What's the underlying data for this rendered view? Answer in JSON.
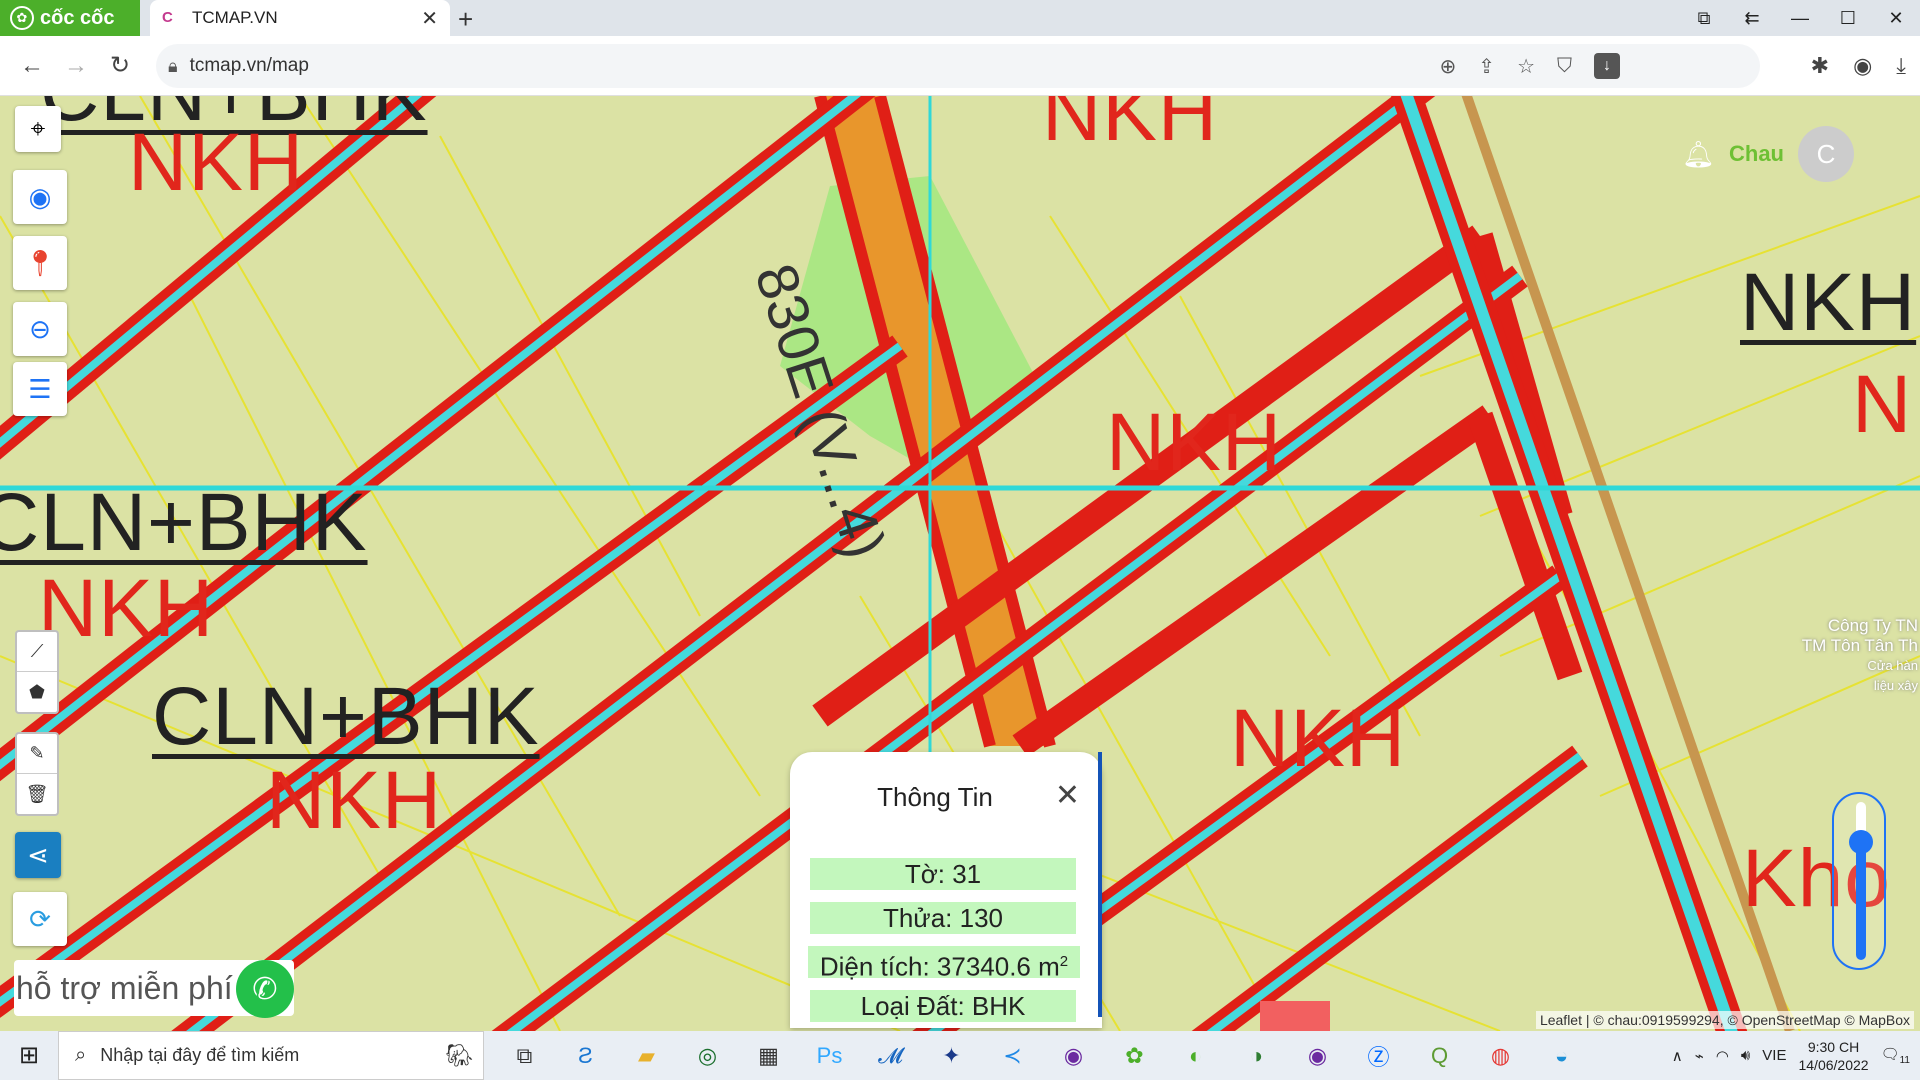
{
  "browser": {
    "brand": "cốc cốc",
    "tab_title": "TCMAP.VN",
    "url": "tcmap.vn/map"
  },
  "map": {
    "labels": [
      {
        "text": "CLN+BHK",
        "kind": "black"
      },
      {
        "text": "NKH",
        "kind": "red"
      },
      {
        "text": "NKH",
        "kind": "red"
      },
      {
        "text": "NKH",
        "kind": "red"
      },
      {
        "text": "CLN+BHK",
        "kind": "black"
      },
      {
        "text": "NKH",
        "kind": "red"
      },
      {
        "text": "CLN+BHK",
        "kind": "black"
      },
      {
        "text": "NKH",
        "kind": "red"
      },
      {
        "text": "NKH",
        "kind": "red"
      },
      {
        "text": "NKH",
        "kind": "black"
      },
      {
        "text": "N",
        "kind": "red"
      },
      {
        "text": "Kho",
        "kind": "red"
      }
    ],
    "road_label": "830E (V...4)",
    "poi": {
      "line1": "Công Ty TN",
      "line2": "TM Tôn Tân Th",
      "line3": "Cửa hàn",
      "line4": "liệu xây"
    },
    "attribution": "Leaflet | © chau:0919599294, © OpenStreetMap © MapBox"
  },
  "user": {
    "name": "Chau",
    "initial": "C"
  },
  "support_text": "hỗ trợ miễn phí",
  "popup": {
    "title": "Thông Tin",
    "to": "Tờ: 31",
    "thua": "Thửa: 130",
    "dien_tich": "Diện tích: 37340.6 m",
    "dien_tich_unit_sup": "2",
    "loai_dat": "Loại Đất: BHK"
  },
  "zoom_slider": {
    "level": 0.75
  },
  "taskbar": {
    "search_placeholder": "Nhập tại đây để tìm kiếm",
    "lang": "VIE",
    "time": "9:30 CH",
    "date": "14/06/2022",
    "notifications": "11"
  }
}
